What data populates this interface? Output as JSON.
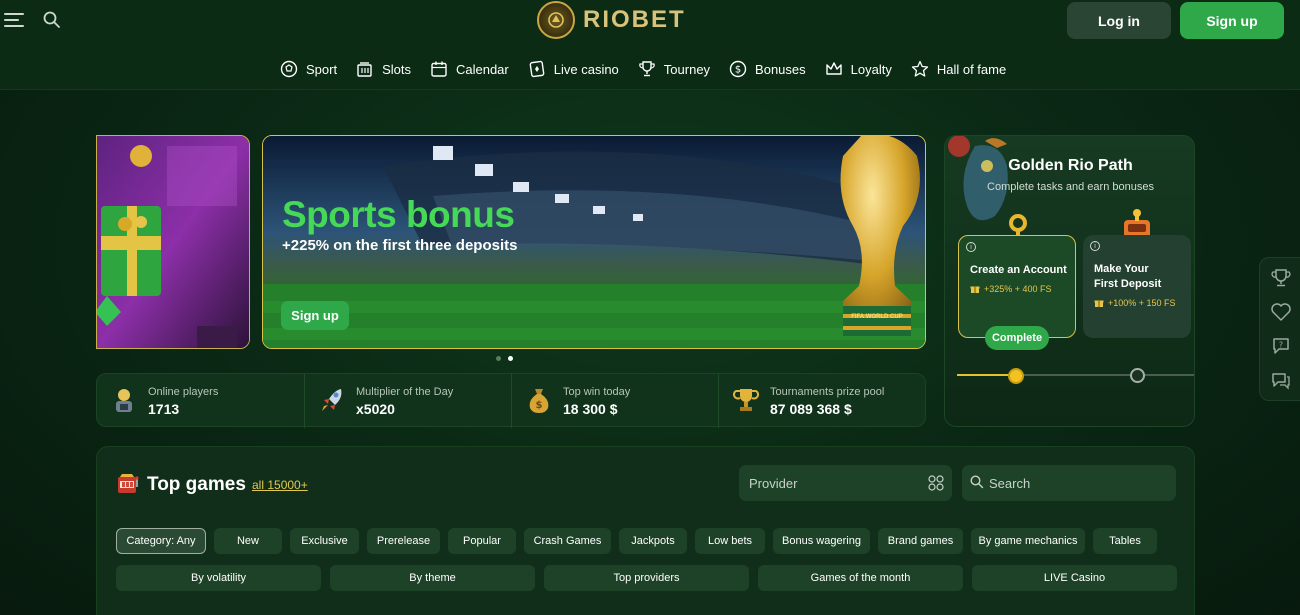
{
  "header": {
    "logo_text": "RIOBET",
    "login_label": "Log in",
    "signup_label": "Sign up"
  },
  "nav": {
    "items": [
      {
        "label": "Sport",
        "icon": "ball-icon"
      },
      {
        "label": "Slots",
        "icon": "slot-machine-icon"
      },
      {
        "label": "Calendar",
        "icon": "calendar-icon"
      },
      {
        "label": "Live casino",
        "icon": "live-casino-icon"
      },
      {
        "label": "Tourney",
        "icon": "trophy-icon"
      },
      {
        "label": "Bonuses",
        "icon": "coin-icon"
      },
      {
        "label": "Loyalty",
        "icon": "crown-icon"
      },
      {
        "label": "Hall of fame",
        "icon": "star-icon"
      }
    ]
  },
  "banner": {
    "title": "Sports bonus",
    "subtitle": "+225% on the first three deposits",
    "cta_label": "Sign up",
    "cup_label": "FIFA WORLD CUP"
  },
  "stats": [
    {
      "label": "Online players",
      "value": "1713",
      "icon": "player-icon"
    },
    {
      "label": "Multiplier of the Day",
      "value": "x5020",
      "icon": "rocket-icon"
    },
    {
      "label": "Top win today",
      "value": "18 300 $",
      "icon": "money-bag-icon"
    },
    {
      "label": "Tournaments prize pool",
      "value": "87 089 368 $",
      "icon": "trophy-icon"
    }
  ],
  "rio_path": {
    "title": "Golden Rio Path",
    "subtitle": "Complete tasks and earn bonuses",
    "tasks": [
      {
        "title_line1": "Create an Account",
        "title_line2": "",
        "reward": "+325% + 400 FS"
      },
      {
        "title_line1": "Make Your",
        "title_line2": "First Deposit",
        "reward": "+100% + 150 FS"
      }
    ],
    "complete_label": "Complete",
    "progress_fraction": 0.25
  },
  "top_games": {
    "title": "Top games",
    "all_label": "all 15000+",
    "provider_placeholder": "Provider",
    "search_placeholder": "Search",
    "chips": [
      "Category: Any",
      "New",
      "Exclusive",
      "Prerelease",
      "Popular",
      "Crash Games",
      "Jackpots",
      "Low bets",
      "Bonus wagering",
      "Brand games",
      "By game mechanics",
      "Tables"
    ],
    "filters": [
      "By volatility",
      "By theme",
      "Top providers",
      "Games of the month",
      "LIVE Casino"
    ]
  },
  "colors": {
    "accent_green": "#2fa84a",
    "banner_title_green": "#46d957",
    "gold": "#d7c24c",
    "background": "#0a2614"
  }
}
